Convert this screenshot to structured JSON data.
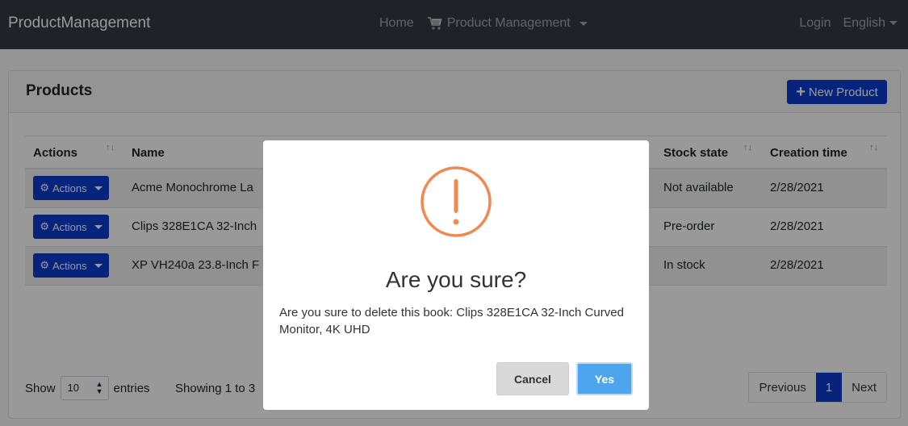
{
  "navbar": {
    "brand": "ProductManagement",
    "home": "Home",
    "product_management": "Product Management",
    "cart_icon": "cart-icon",
    "login": "Login",
    "language": "English"
  },
  "card": {
    "title": "Products",
    "new_product": "New Product"
  },
  "table": {
    "headers": [
      "Actions",
      "Name",
      "Stock state",
      "Creation time"
    ],
    "rows": [
      {
        "actions": "Actions",
        "name": "Acme Monochrome La",
        "stock": "Not available",
        "created": "2/28/2021"
      },
      {
        "actions": "Actions",
        "name": "Clips 328E1CA 32-Inch",
        "stock": "Pre-order",
        "created": "2/28/2021"
      },
      {
        "actions": "Actions",
        "name": "XP VH240a 23.8-Inch F",
        "stock": "In stock",
        "created": "2/28/2021"
      }
    ]
  },
  "footer": {
    "show": "Show",
    "page_size": "10",
    "entries": "entries",
    "info": "Showing 1 to 3",
    "previous": "Previous",
    "current_page": "1",
    "next": "Next"
  },
  "modal": {
    "title": "Are you sure?",
    "message": "Are you sure to delete this book: Clips 328E1CA 32-Inch Curved Monitor, 4K UHD",
    "cancel": "Cancel",
    "yes": "Yes",
    "icon_color": "#f0894f"
  }
}
